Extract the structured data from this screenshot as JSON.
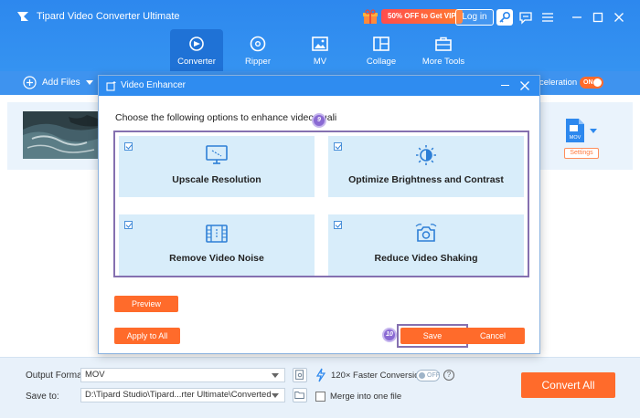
{
  "app": {
    "title": "Tipard Video Converter Ultimate",
    "promo": "50% OFF to Get VIP",
    "login_label": "Log in",
    "accent_color": "#2f8cf0",
    "action_color": "#ff6b2b"
  },
  "nav": {
    "tabs": [
      {
        "label": "Converter",
        "icon": "converter-icon",
        "active": true
      },
      {
        "label": "Ripper",
        "icon": "disc-icon",
        "active": false
      },
      {
        "label": "MV",
        "icon": "image-icon",
        "active": false
      },
      {
        "label": "Collage",
        "icon": "collage-icon",
        "active": false
      },
      {
        "label": "More Tools",
        "icon": "toolbox-icon",
        "active": false
      }
    ]
  },
  "toolbar": {
    "add_files_label": "Add Files",
    "acceleration_label": "celeration",
    "acceleration_toggle": "ON"
  },
  "file_item": {
    "format_badge": "MOV",
    "settings_label": "Settings"
  },
  "dialog": {
    "title": "Video Enhancer",
    "instruction": "Choose the following options to enhance video quali",
    "step_badges": [
      "9",
      "10"
    ],
    "options": [
      {
        "label": "Upscale Resolution",
        "checked": true,
        "icon": "monitor-icon"
      },
      {
        "label": "Optimize Brightness and Contrast",
        "checked": true,
        "icon": "brightness-icon"
      },
      {
        "label": "Remove Video Noise",
        "checked": true,
        "icon": "film-icon"
      },
      {
        "label": "Reduce Video Shaking",
        "checked": true,
        "icon": "camera-shake-icon"
      }
    ],
    "preview_label": "Preview",
    "apply_all_label": "Apply to All",
    "save_label": "Save",
    "cancel_label": "Cancel"
  },
  "bottom": {
    "output_format_label": "Output Format:",
    "output_format_value": "MOV",
    "save_to_label": "Save to:",
    "save_to_value": "D:\\Tipard Studio\\Tipard...rter Ultimate\\Converted",
    "faster_conversion_label": "120× Faster Conversion",
    "faster_toggle": "OFF",
    "merge_label": "Merge into one file",
    "convert_all_label": "Convert All"
  }
}
